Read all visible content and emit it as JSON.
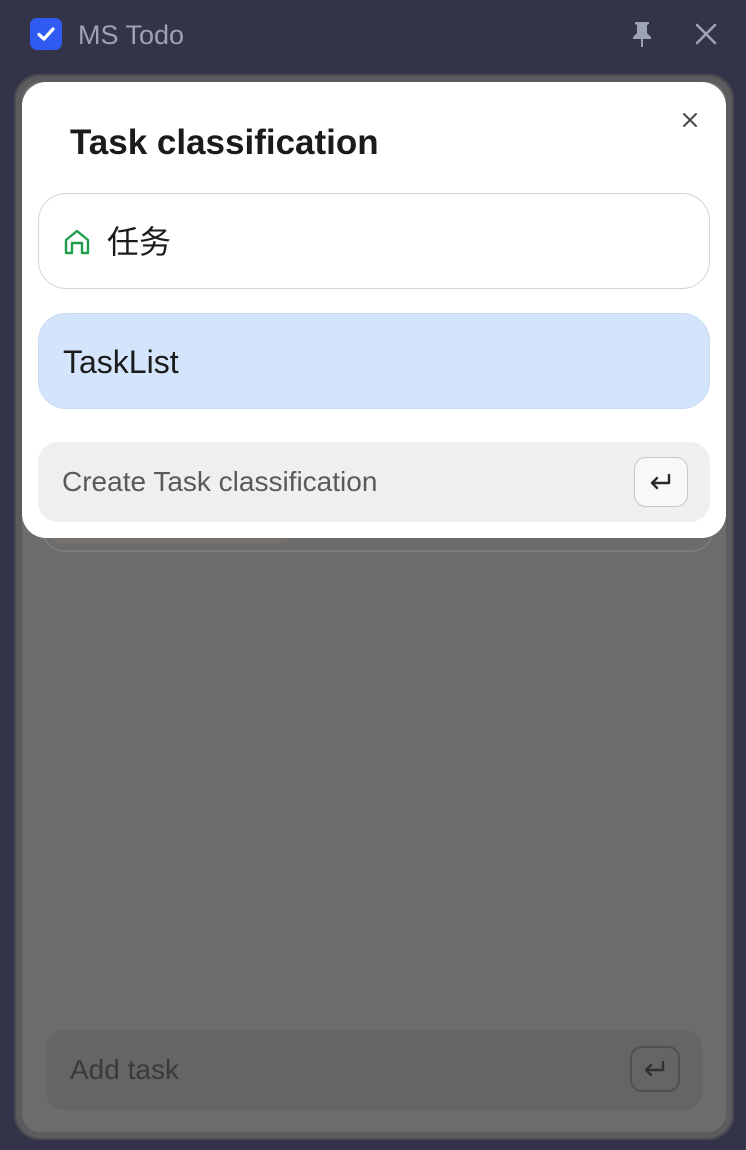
{
  "app": {
    "title": "MS Todo"
  },
  "colors": {
    "accent": "#2f5bf0",
    "selected": "#d3e4fb",
    "home_icon": "#1f9d4c"
  },
  "icons": {
    "app": "checkbox-icon",
    "pin": "pin-icon",
    "close": "close-icon",
    "home": "home-icon",
    "enter": "enter-icon"
  },
  "modal": {
    "title": "Task classification",
    "options": [
      {
        "label": "任务",
        "icon": "home-icon",
        "selected": false
      },
      {
        "label": "TaskList",
        "selected": true
      }
    ],
    "create_placeholder": "Create Task classification"
  },
  "main": {
    "add_task_placeholder": "Add task"
  }
}
